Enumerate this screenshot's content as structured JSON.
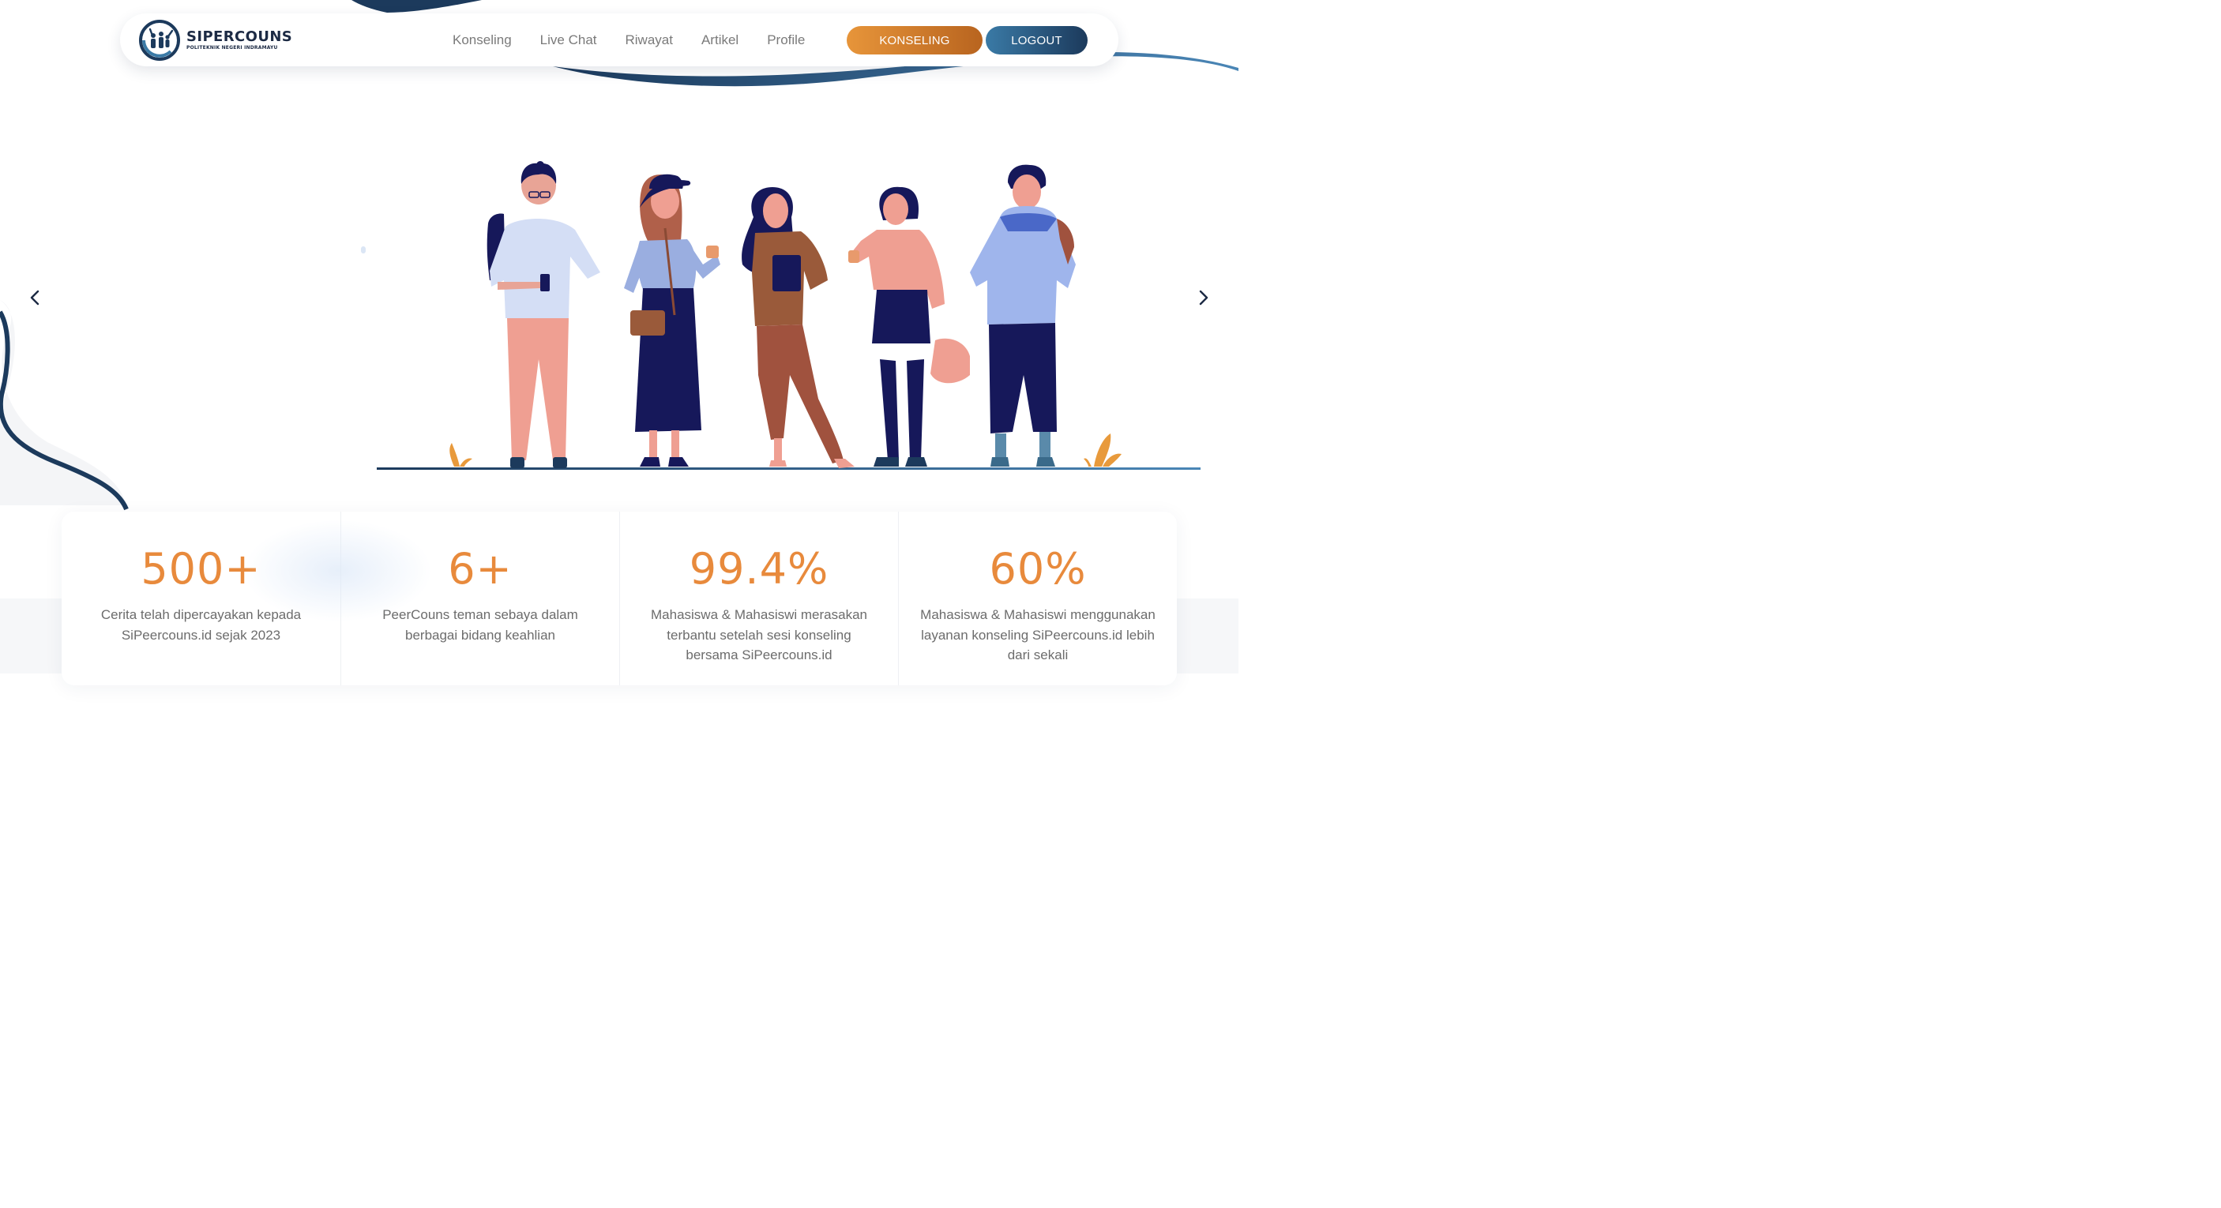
{
  "brand": {
    "title": "SIPERCOUNS",
    "subtitle": "POLITEKNIK NEGERI INDRAMAYU",
    "logo_icon": "family-hands-logo"
  },
  "nav": {
    "links": [
      {
        "label": "Konseling"
      },
      {
        "label": "Live Chat"
      },
      {
        "label": "Riwayat"
      },
      {
        "label": "Artikel"
      },
      {
        "label": "Profile"
      }
    ],
    "konseling_button": "KONSELING",
    "logout_button": "LOGOUT"
  },
  "carousel": {
    "prev_icon": "chevron-left-icon",
    "next_icon": "chevron-right-icon"
  },
  "stats": [
    {
      "value": "500+",
      "description": "Cerita telah dipercayakan kepada SiPeercouns.id sejak 2023"
    },
    {
      "value": "6+",
      "description": "PeerCouns teman sebaya dalam berbagai bidang keahlian"
    },
    {
      "value": "99.4%",
      "description": "Mahasiswa & Mahasiswi merasakan terbantu setelah sesi konseling bersama SiPeercouns.id"
    },
    {
      "value": "60%",
      "description": "Mahasiswa & Mahasiswi menggunakan layanan konseling SiPeercouns.id lebih dari sekali"
    }
  ],
  "colors": {
    "accent_orange": "#e88a3c",
    "navy": "#1c3a5c",
    "text_gray": "#6c6c6c"
  }
}
